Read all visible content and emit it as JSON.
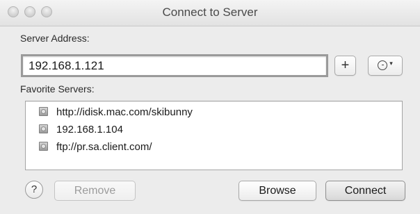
{
  "window": {
    "title": "Connect to Server"
  },
  "server": {
    "label": "Server Address:",
    "value": "192.168.1.121"
  },
  "controls": {
    "add_label": "+",
    "history_caret": "▾"
  },
  "favorites": {
    "label": "Favorite Servers:",
    "items": [
      {
        "text": "http://idisk.mac.com/skibunny",
        "icon": "server-icon"
      },
      {
        "text": "192.168.1.104",
        "icon": "server-icon"
      },
      {
        "text": "ftp://pr.sa.client.com/",
        "icon": "server-icon"
      }
    ]
  },
  "footer": {
    "help_label": "?",
    "remove_label": "Remove",
    "browse_label": "Browse",
    "connect_label": "Connect"
  },
  "colors": {
    "window_bg": "#ececec",
    "disabled_text": "#9c9c9c"
  }
}
